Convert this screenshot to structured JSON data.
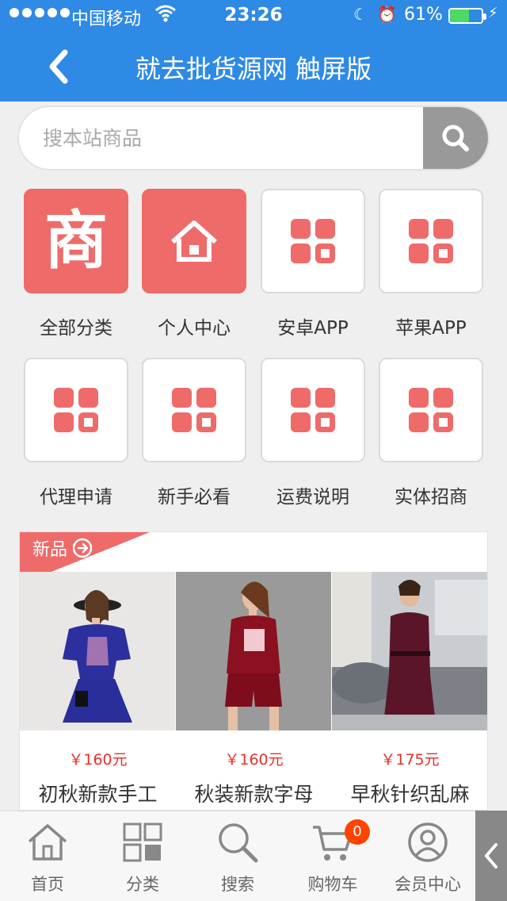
{
  "status_bar": {
    "carrier": "中国移动",
    "time": "23:26",
    "battery": "61%",
    "battery_level": 0.61
  },
  "header": {
    "title": "就去批货源网 触屏版"
  },
  "search": {
    "placeholder": "搜本站商品"
  },
  "grid": {
    "items": [
      {
        "label": "全部分类",
        "icon": "shang-icon"
      },
      {
        "label": "个人中心",
        "icon": "home-icon"
      },
      {
        "label": "安卓APP",
        "icon": "apps-icon"
      },
      {
        "label": "苹果APP",
        "icon": "apps-icon"
      },
      {
        "label": "代理申请",
        "icon": "apps-icon"
      },
      {
        "label": "新手必看",
        "icon": "apps-icon"
      },
      {
        "label": "运费说明",
        "icon": "apps-icon"
      },
      {
        "label": "实体招商",
        "icon": "apps-icon"
      }
    ],
    "shang_char": "商"
  },
  "new_products": {
    "label": "新品",
    "items": [
      {
        "price": "￥160元",
        "name": "初秋新款手工"
      },
      {
        "price": "￥160元",
        "name": "秋装新款字母"
      },
      {
        "price": "￥175元",
        "name": "早秋针织乱麻"
      }
    ]
  },
  "bottom_nav": {
    "items": [
      {
        "label": "首页",
        "icon": "home-icon"
      },
      {
        "label": "分类",
        "icon": "category-icon"
      },
      {
        "label": "搜索",
        "icon": "search-icon"
      },
      {
        "label": "购物车",
        "icon": "cart-icon"
      },
      {
        "label": "会员中心",
        "icon": "user-icon"
      }
    ],
    "cart_count": "0"
  },
  "colors": {
    "header_bg": "#2f8ae5",
    "accent_red": "#ee6b6a",
    "price_red": "#e8302a"
  }
}
